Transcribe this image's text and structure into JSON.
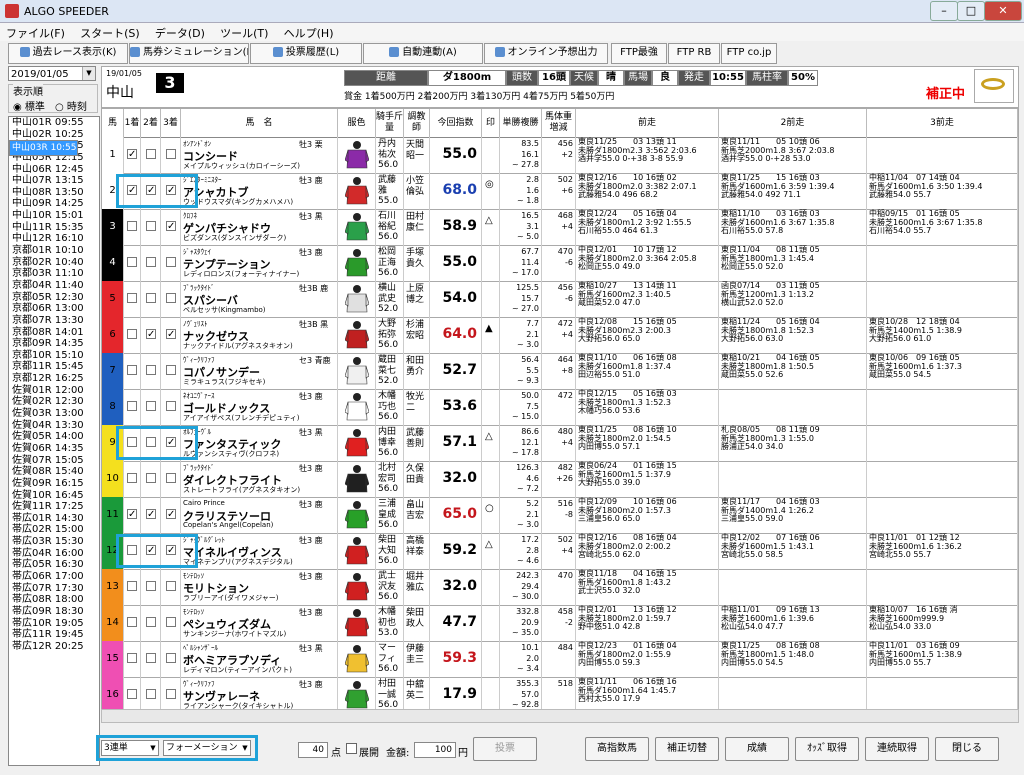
{
  "app": {
    "title": "ALGO SPEEDER",
    "min": "–",
    "max": "□",
    "close": "✕"
  },
  "menu": [
    "ファイル(F)",
    "スタート(S)",
    "データ(D)",
    "ツール(T)",
    "ヘルプ(H)"
  ],
  "toolbar": [
    "過去レース表示(K)",
    "馬券シミュレーション(B)",
    "投票履歴(L)",
    "自動連動(A)",
    "オンライン予想出力",
    "FTP最強",
    "FTP RB",
    "FTP co.jp"
  ],
  "left": {
    "date": "2019/01/05",
    "order_label": "表示順",
    "order_opts": [
      "標準",
      "時刻"
    ],
    "races": [
      "中山01R 09:55",
      "中山02R 10:25",
      "中山03R 10:55",
      "中山04R 11:25",
      "中山05R 12:15",
      "中山06R 12:45",
      "中山07R 13:15",
      "中山08R 13:50",
      "中山09R 14:25",
      "中山10R 15:01",
      "中山11R 15:35",
      "中山12R 16:10",
      "京都01R 10:10",
      "京都02R 10:40",
      "京都03R 11:10",
      "京都04R 11:40",
      "京都05R 12:30",
      "京都06R 13:00",
      "京都07R 13:30",
      "京都08R 14:01",
      "京都09R 14:35",
      "京都10R 15:10",
      "京都11R 15:45",
      "京都12R 16:25",
      "佐賀01R 12:00",
      "佐賀02R 12:30",
      "佐賀03R 13:00",
      "佐賀04R 13:30",
      "佐賀05R 14:00",
      "佐賀06R 14:35",
      "佐賀07R 15:05",
      "佐賀08R 15:40",
      "佐賀09R 16:15",
      "佐賀10R 16:45",
      "佐賀11R 17:25",
      "帯広01R 14:30",
      "帯広02R 15:00",
      "帯広03R 15:30",
      "帯広04R 16:00",
      "帯広05R 16:30",
      "帯広06R 17:00",
      "帯広07R 17:30",
      "帯広08R 18:00",
      "帯広09R 18:30",
      "帯広10R 19:05",
      "帯広11R 19:45",
      "帯広12R 20:25"
    ],
    "selected_index": 2
  },
  "header": {
    "date": "19/01/05",
    "venue": "中山",
    "race_no": "3",
    "dist_lbl": "距離",
    "dist": "ダ1800m",
    "heads_lbl": "頭数",
    "heads": "16頭",
    "weather_lbl": "天候",
    "weather": "晴",
    "track_lbl": "馬場",
    "cond": "良",
    "start_lbl": "発走",
    "start": "10:55",
    "rate_lbl": "馬柱率",
    "rate": "50%",
    "prize": "賞金 1着500万円 2着200万円 3着130万円 4着75万円 5着50万円",
    "status": "補正中"
  },
  "columns": [
    "馬",
    "1着",
    "2着",
    "3着",
    "馬　名",
    "服色",
    "騎手斤量",
    "調教師",
    "今回指数",
    "印",
    "単勝複勝",
    "馬体重増減",
    "前走",
    "2前走",
    "3前走"
  ],
  "horses": [
    {
      "no": "1",
      "sire": "ｵﾝｱﾝﾄﾞｵﾝ",
      "name": "コンシード",
      "dam": "メイプルウィッシュ",
      "dam_sire": "(カロイーシーズ)",
      "sex": "牡3 栗",
      "jockey": "丹内\n祐次\n56.0",
      "trainer": "天間\n昭一",
      "idx": "55.0",
      "idx_color": "#000",
      "mark": "",
      "odds": "83.5\n16.1\n~ 27.8",
      "weight": "456\n+2",
      "c1": true,
      "c2": false,
      "c3": false,
      "p1": "東良11/25　　03 13頭 11\n未勝ダ1800m2.3 3:562 2:03.6\n酒井学55.0 0-+38 3-8 55.9",
      "p2": "東良11/11　　05 10頭 06\n新馬芝2000m1.8 3:67 2:03.8\n酒井学55.0 0-+28 53.0",
      "p3": ""
    },
    {
      "no": "2",
      "sire": "ｼﾞｴｽﾀｰﾐﾆｽﾀｰ",
      "name": "アシャカトブ",
      "dam": "ウッドウスマダ",
      "dam_sire": "(キングカメハメハ)",
      "sex": "牡3 鹿",
      "jockey": "武藤\n雅\n55.0",
      "trainer": "小笠\n倫弘",
      "idx": "68.0",
      "idx_color": "#1a3fb0",
      "mark": "◎",
      "odds": "2.8\n1.6\n~ 1.8",
      "weight": "502\n+6",
      "c1": true,
      "c2": true,
      "c3": true,
      "p1": "東良12/16　　10 16頭 02\n未勝ダ1800m2.0 3:382 2:07.1\n武藤雅54.0 496 68.2",
      "p2": "東良11/25　　15 16頭 03\n新馬ダ1600m1.6 3:59 1:39.4\n武藤雅54.0 492 71.1",
      "p3": "中稲11/04　07 14頭 04\n新馬ダ1600m1.6 3:50 1:39.4\n武藤雅54.0 55.7"
    },
    {
      "no": "3",
      "sire": "ｸﾛﾌﾈ",
      "name": "ゲンパチシャドウ",
      "dam": "ビズダンス",
      "dam_sire": "(ダンスインザダーク)",
      "sex": "牡3 黒",
      "jockey": "石川\n裕紀\n56.0",
      "trainer": "田村\n康仁",
      "idx": "58.9",
      "idx_color": "#000",
      "mark": "△",
      "odds": "16.5\n3.1\n~ 5.0",
      "weight": "468\n+4",
      "c1": false,
      "c2": false,
      "c3": true,
      "p1": "東良12/24　　05 16頭 04\n未勝ダ1800m1.2 3:92 1:55.5\n石川裕55.0 464 61.3",
      "p2": "東稲11/10　　03 16頭 03\n未勝ダ1600m1.6 3:67 1:35.8\n石川裕55.0 57.8",
      "p3": "中稲09/15　01 16頭 05\n未勝芝1600m1.6 3:67 1:35.8\n石川裕54.0 55.7"
    },
    {
      "no": "4",
      "sire": "ｼﾞｬｽﾀｳｪｲ",
      "name": "テンプテーション",
      "dam": "レディロロンス",
      "dam_sire": "(フォーティナイナー)",
      "sex": "牡3 鹿",
      "jockey": "松岡\n正海\n56.0",
      "trainer": "手塚\n貴久",
      "idx": "55.0",
      "idx_color": "#000",
      "mark": "",
      "odds": "67.7\n11.4\n~ 17.0",
      "weight": "470\n-6",
      "c1": false,
      "c2": false,
      "c3": false,
      "p1": "中良12/01　　10 17頭 12\n未勝ダ1800m2.0 3:364 2:05.8\n松岡正55.0 49.0",
      "p2": "東良11/04　　08 11頭 05\n新馬芝1800m1.3 1:45.4\n松岡正55.0 52.0",
      "p3": ""
    },
    {
      "no": "5",
      "sire": "ﾌﾞﾗｯｸﾀｲﾄﾞ",
      "name": "スパシーバ",
      "dam": "ベルセッサ",
      "dam_sire": "(Kingmambo)",
      "sex": "牡3B 鹿",
      "jockey": "横山\n武史\n52.0",
      "trainer": "上原\n博之",
      "idx": "54.0",
      "idx_color": "#000",
      "mark": "",
      "odds": "125.5\n15.7\n~ 27.0",
      "weight": "456\n-6",
      "c1": false,
      "c2": false,
      "c3": false,
      "p1": "東稲10/27　　13 14頭 11\n新馬ダ1600m2.3 1:40.5\n蔵田菜52.0 47.0",
      "p2": "函良07/14　　03 11頭 05\n新馬芝1200m1.3 1:13.2\n横山武52.0 52.0",
      "p3": ""
    },
    {
      "no": "6",
      "sire": "ﾉｳﾞｪﾘｽﾄ",
      "name": "ナックゼウス",
      "dam": "ナックアイドル",
      "dam_sire": "(アグネスタキオン)",
      "sex": "牡3B 黒",
      "jockey": "大野\n拓弥\n56.0",
      "trainer": "杉浦\n宏昭",
      "idx": "64.0",
      "idx_color": "#c4161c",
      "mark": "▲",
      "odds": "7.7\n2.1\n~ 3.0",
      "weight": "472\n+4",
      "c1": false,
      "c2": true,
      "c3": true,
      "p1": "中良12/08　　15 16頭 05\n未勝ダ1800m2.3 2:00.3\n大野拓56.0 65.0",
      "p2": "東稲11/24　　05 16頭 04\n未勝芝1800m1.8 1:52.3\n大野拓56.0 63.0",
      "p3": "東良10/28　12 18頭 04\n新馬芝1400m1.5 1:38.9\n大野拓56.0 61.0"
    },
    {
      "no": "7",
      "sire": "ｳﾞｨｰｸﾘﾌｧﾌ",
      "name": "コパノサンデー",
      "dam": "ミラキュラス",
      "dam_sire": "(フジキセキ)",
      "sex": "セ3 青鹿",
      "jockey": "蔵田\n菜七\n52.0",
      "trainer": "和田\n勇介",
      "idx": "52.7",
      "idx_color": "#000",
      "mark": "",
      "odds": "56.4\n5.5\n~ 9.3",
      "weight": "464\n+8",
      "c1": false,
      "c2": false,
      "c3": false,
      "p1": "東良11/10　　06 16頭 08\n未勝ダ1600m1.8 1:37.4\n田辺裕55.0 51.0",
      "p2": "東稲10/21　　04 16頭 05\n未勝芝1800m1.8 1:50.5\n蔵田菜55.0 52.6",
      "p3": "東良10/06　09 16頭 05\n新馬芝1600m1.6 1:37.3\n蔵田菜55.0 54.5"
    },
    {
      "no": "8",
      "sire": "ﾈｵﾕﾆｳﾞｧｰｽ",
      "name": "ゴールドノックス",
      "dam": "アイアイザベス",
      "dam_sire": "(フレンチデピュティ)",
      "sex": "牡3 鹿",
      "jockey": "木幡\n巧也\n56.0",
      "trainer": "牧光\n二",
      "idx": "53.6",
      "idx_color": "#000",
      "mark": "",
      "odds": "50.0\n7.5\n~ 15.0",
      "weight": "472\n",
      "c1": false,
      "c2": false,
      "c3": false,
      "p1": "中良12/15　　05 16頭 03\n未勝芝1800m1.3 1:52.3\n木幡巧56.0 53.6",
      "p2": "",
      "p3": ""
    },
    {
      "no": "9",
      "sire": "ｵﾙﾌｪｰｳﾞﾙ",
      "name": "ファンタスティック",
      "dam": "ルヴァンシスティヴ",
      "dam_sire": "(クロフネ)",
      "sex": "牡3 黒",
      "jockey": "内田\n博幸\n56.0",
      "trainer": "武藤\n善則",
      "idx": "57.1",
      "idx_color": "#000",
      "mark": "△",
      "odds": "86.6\n12.1\n~ 17.8",
      "weight": "480\n+4",
      "c1": false,
      "c2": false,
      "c3": true,
      "p1": "東良11/25　　08 16頭 10\n未勝芝1800m2.0 1:54.5\n内田博55.0 57.1",
      "p2": "札良08/05　　08 11頭 09\n新馬芝1800m1.3 1:55.0\n勝浦正54.0 34.0",
      "p3": ""
    },
    {
      "no": "10",
      "sire": "ﾌﾞﾗｯｸﾀｲﾄﾞ",
      "name": "ダイレクトフライト",
      "dam": "ストレートフライ",
      "dam_sire": "(アグネスタキオン)",
      "sex": "牡3 鹿",
      "jockey": "北村\n宏司\n56.0",
      "trainer": "久保\n田貴",
      "idx": "32.0",
      "idx_color": "#000",
      "mark": "",
      "odds": "126.3\n4.6\n~ 7.2",
      "weight": "482\n+26",
      "c1": false,
      "c2": false,
      "c3": false,
      "p1": "東良06/24　　01 16頭 15\n新馬芝1600m1.5 1:37.9\n大野拓55.0 39.0",
      "p2": "",
      "p3": ""
    },
    {
      "no": "11",
      "sire": "Cairo Prince",
      "name": "クラリステソーロ",
      "dam": "Copelan's Angel",
      "dam_sire": "(Copelan)",
      "sex": "牡3 鹿",
      "jockey": "三浦\n皇成\n56.0",
      "trainer": "畠山\n吉宏",
      "idx": "65.0",
      "idx_color": "#c4161c",
      "mark": "○",
      "odds": "5.2\n2.1\n~ 3.0",
      "weight": "516\n-8",
      "c1": true,
      "c2": true,
      "c3": true,
      "p1": "中良12/09　　10 16頭 06\n未勝ダ1800m2.0 1:57.3\n三浦皇56.0 65.0",
      "p2": "東良11/17　　04 16頭 03\n新馬ダ1400m1.4 1:26.2\n三浦皇55.0 59.0",
      "p3": ""
    },
    {
      "no": "12",
      "sire": "ｼﾞｬｯｸﾞﾙｸﾞﾚｯﾄ",
      "name": "マイネルイヴィンス",
      "dam": "マイネテンプリ",
      "dam_sire": "(アグネスデジタル)",
      "sex": "牡3 鹿",
      "jockey": "柴田\n大知\n56.0",
      "trainer": "高橋\n祥泰",
      "idx": "59.2",
      "idx_color": "#000",
      "mark": "△",
      "odds": "17.2\n2.8\n~ 4.6",
      "weight": "502\n+4",
      "c1": false,
      "c2": true,
      "c3": true,
      "p1": "中良12/16　　08 16頭 04\n未勝ダ1800m2.0 2:00.2\n宮崎北55.0 62.0",
      "p2": "中良12/02　　07 16頭 06\n未勝ダ1600m1.5 1:43.1\n宮崎北55.0 58.5",
      "p3": "中良11/01　01 12頭 12\n未勝芝1600m1.6 1:36.2\n宮崎北55.0 55.7"
    },
    {
      "no": "13",
      "sire": "ﾓﾝﾃﾛｯｿ",
      "name": "モリトション",
      "dam": "ラブリーアイ",
      "dam_sire": "(ダイワメジャー)",
      "sex": "牡3 鹿",
      "jockey": "武士\n沢友\n56.0",
      "trainer": "堀井\n雅広",
      "idx": "32.0",
      "idx_color": "#000",
      "mark": "",
      "odds": "242.3\n29.4\n~ 30.0",
      "weight": "470\n",
      "c1": false,
      "c2": false,
      "c3": false,
      "p1": "東良11/18　　04 16頭 15\n新馬ダ1600m1.8 1:43.2\n武士沢55.0 32.0",
      "p2": "",
      "p3": ""
    },
    {
      "no": "14",
      "sire": "ﾓﾝﾃﾛｯｿ",
      "name": "ペシュウィズダム",
      "dam": "サンキンジーナ",
      "dam_sire": "(ホワイトマズル)",
      "sex": "牡3 鹿",
      "jockey": "木幡\n初也\n53.0",
      "trainer": "柴田\n政人",
      "idx": "47.7",
      "idx_color": "#000",
      "mark": "",
      "odds": "332.8\n20.9\n~ 35.0",
      "weight": "458\n-2",
      "c1": false,
      "c2": false,
      "c3": false,
      "p1": "中良12/01　　13 16頭 12\n未勝芝1800m2.0 1:59.7\n野中悠51.0 42.8",
      "p2": "中稲11/01　　09 16頭 13\n未勝芝1600m1.6 1:39.6\n松山弘54.0 47.7",
      "p3": "東稲10/07　16 16頭 消\n未勝芝1600m999.9\n松山弘54.0 33.0"
    },
    {
      "no": "15",
      "sire": "ﾍﾟﾙｼｬﾝｻﾞｰﾙ",
      "name": "ボヘミアラプソディ",
      "dam": "レディマロン",
      "dam_sire": "(ティーアインパクト)",
      "sex": "牡3 黒",
      "jockey": "マー\nフィ\n56.0",
      "trainer": "伊藤\n圭三",
      "idx": "59.3",
      "idx_color": "#c4161c",
      "mark": "",
      "odds": "10.1\n2.0\n~ 3.4",
      "weight": "484\n",
      "c1": false,
      "c2": false,
      "c3": false,
      "p1": "中良12/23　　01 16頭 04\n新馬ダ1800m2.0 1:55.9\n内田博55.0 59.3",
      "p2": "東良11/25　　08 16頭 08\n新馬芝1800m1.5 1:48.0\n内田博55.0 54.5",
      "p3": "中良11/01　03 16頭 09\n新馬芝1600m1.5 1:38.9\n内田博55.0 55.7"
    },
    {
      "no": "16",
      "sire": "ｳﾞｨｰｸﾘﾌｧﾌ",
      "name": "サンヴァレーネ",
      "dam": "ライアンシャーク",
      "dam_sire": "(タイキシャトル)",
      "sex": "牡3 鹿",
      "jockey": "村田\n一誠\n56.0",
      "trainer": "中舘\n英二",
      "idx": "17.9",
      "idx_color": "#000",
      "mark": "",
      "odds": "355.3\n57.0\n~ 92.8",
      "weight": "518\n",
      "c1": false,
      "c2": false,
      "c3": false,
      "p1": "東良11/11　　06 16頭 16\n新馬ダ1600m1.64 1:45.7\n西村太55.0 17.9",
      "p2": "",
      "p3": ""
    }
  ],
  "waku_colors": [
    "#ffffff",
    "#000000",
    "#e4262c",
    "#1f5fbf",
    "#f4e01e",
    "#1a9a3a",
    "#f28e1c",
    "#ef4fb3"
  ],
  "bottom": {
    "bet_type": "3連単",
    "bet_mode": "フォーメーション",
    "points": "40",
    "points_unit": "点",
    "expand_label": "展開",
    "amount_label": "金額:",
    "amount": "100",
    "amount_unit": "円",
    "vote": "投票",
    "buttons": [
      "高指数馬",
      "補正切替",
      "成績",
      "ｵｯｽﾞ取得",
      "連続取得",
      "閉じる"
    ]
  }
}
